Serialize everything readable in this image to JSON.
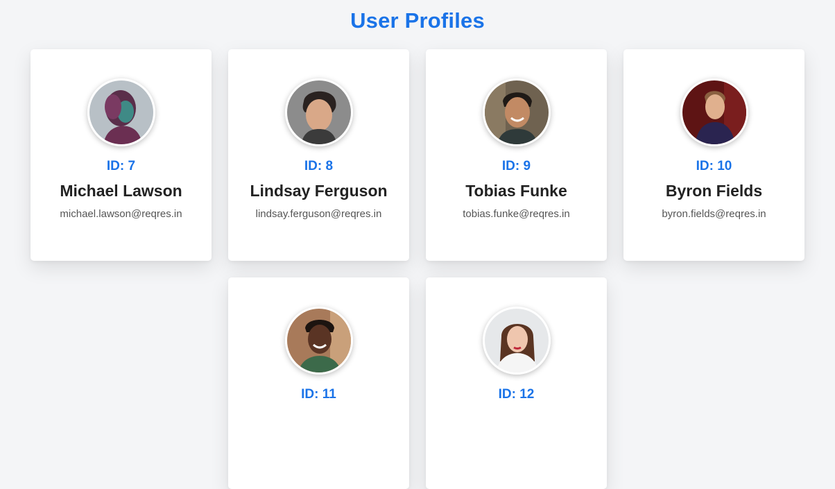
{
  "page": {
    "title": "User Profiles"
  },
  "colors": {
    "accent": "#1a73e8",
    "background": "#f4f5f7",
    "card": "#ffffff"
  },
  "users": [
    {
      "id_label": "ID: 7",
      "name": "Michael Lawson",
      "email": "michael.lawson@reqres.in",
      "avatar": "portrait-photo-7"
    },
    {
      "id_label": "ID: 8",
      "name": "Lindsay Ferguson",
      "email": "lindsay.ferguson@reqres.in",
      "avatar": "portrait-photo-8"
    },
    {
      "id_label": "ID: 9",
      "name": "Tobias Funke",
      "email": "tobias.funke@reqres.in",
      "avatar": "portrait-photo-9"
    },
    {
      "id_label": "ID: 10",
      "name": "Byron Fields",
      "email": "byron.fields@reqres.in",
      "avatar": "portrait-photo-10"
    },
    {
      "id_label": "ID: 11",
      "name": "",
      "email": "",
      "avatar": "portrait-photo-11"
    },
    {
      "id_label": "ID: 12",
      "name": "",
      "email": "",
      "avatar": "portrait-photo-12"
    }
  ]
}
